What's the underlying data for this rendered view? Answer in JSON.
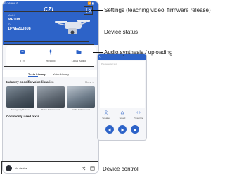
{
  "status_bar": {
    "time": "11:26 AM ⊙",
    "right_icons": "📶 ▮"
  },
  "header": {
    "logo": "CZI",
    "model_label": "Model",
    "model_value": "MP108",
    "id_label": "ID",
    "id_value": "1PNE21J308"
  },
  "features": [
    {
      "label": "TTS",
      "icon": "tts-icon"
    },
    {
      "label": "Record",
      "icon": "microphone-icon"
    },
    {
      "label": "Local Audio",
      "icon": "folder-icon"
    }
  ],
  "tabs": [
    {
      "label": "Texts Library",
      "active": true
    },
    {
      "label": "Voice Library",
      "active": false
    }
  ],
  "library": {
    "section_title": "Industry-specific voice libraries",
    "more_label": "More >",
    "items": [
      "Emergency Rescue",
      "Police Enforcement",
      "Traffic Enforcement"
    ],
    "common_title": "Commonly used texts"
  },
  "device": {
    "name": "No device"
  },
  "tts_panel": {
    "placeholder": "Please enter text",
    "actions": [
      "Speaker",
      "Speed",
      "Preset line"
    ]
  },
  "callouts": {
    "settings": "Settings (teaching video, firmware release)",
    "device_status": "Device status",
    "audio": "Audio synthesis / uploading",
    "device_control": "Device control"
  },
  "colors": {
    "primary": "#2d63c8",
    "background": "#f5f6f9"
  }
}
